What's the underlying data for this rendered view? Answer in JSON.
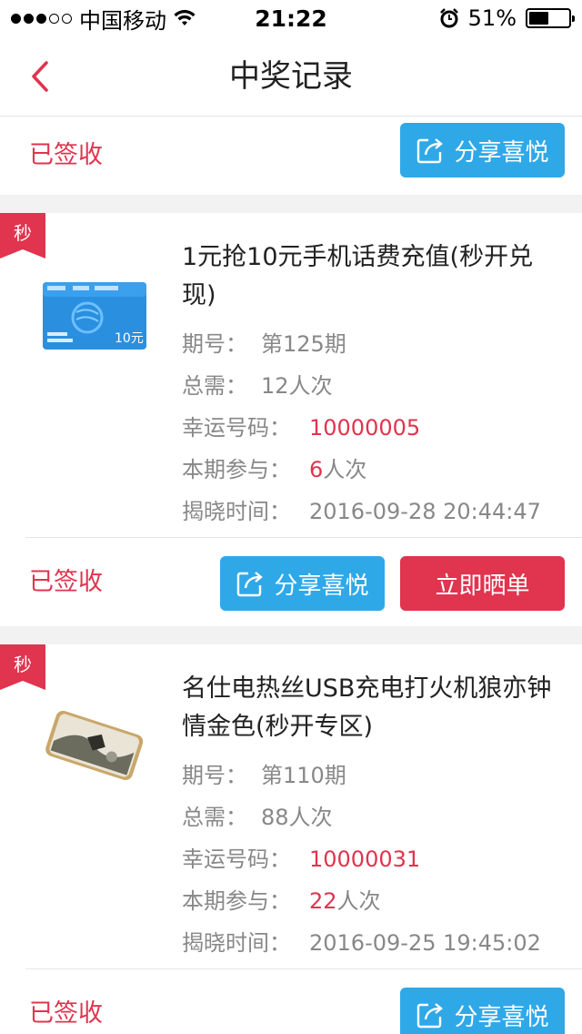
{
  "status_bar": {
    "carrier": "中国移动",
    "time": "21:22",
    "battery": "51%",
    "signal_bars": 3,
    "battery_level": 0.51
  },
  "nav": {
    "title": "中奖记录"
  },
  "top_action": {
    "status": "已签收",
    "share_label": "分享喜悦"
  },
  "items": [
    {
      "tag": "秒",
      "title": "1元抢10元手机话费充值(秒开兑现)",
      "period_label": "期号：",
      "period": "第125期",
      "total_label": "总需：",
      "total": "12人次",
      "lucky_label": "幸运号码：",
      "lucky": "10000005",
      "joined_label": "本期参与：",
      "joined_num": "6",
      "joined_unit": "人次",
      "time_label": "揭晓时间：",
      "time": "2016-09-28 20:44:47",
      "status": "已签收",
      "share_label": "分享喜悦",
      "show_label": "立即晒单",
      "card_value": "10元"
    },
    {
      "tag": "秒",
      "title": "名仕电热丝USB充电打火机狼亦钟情金色(秒开专区)",
      "period_label": "期号：",
      "period": "第110期",
      "total_label": "总需：",
      "total": "88人次",
      "lucky_label": "幸运号码：",
      "lucky": "10000031",
      "joined_label": "本期参与：",
      "joined_num": "22",
      "joined_unit": "人次",
      "time_label": "揭晓时间：",
      "time": "2016-09-25 19:45:02",
      "status": "已签收",
      "share_label": "分享喜悦"
    }
  ],
  "colors": {
    "accent_red": "#e0344f",
    "share_blue": "#2fa8e8"
  }
}
